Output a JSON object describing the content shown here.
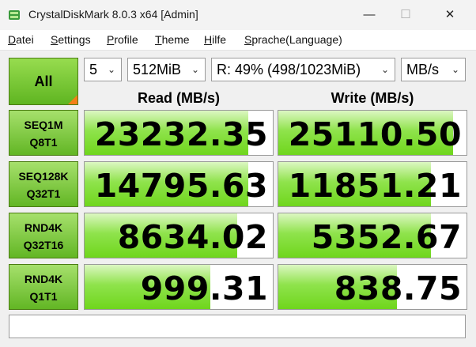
{
  "window": {
    "title": "CrystalDiskMark 8.0.3 x64 [Admin]",
    "minimize": "—",
    "maximize": "☐",
    "close": "✕"
  },
  "menu": [
    {
      "u": "D",
      "rest": "atei"
    },
    {
      "u": "S",
      "rest": "ettings"
    },
    {
      "u": "P",
      "rest": "rofile"
    },
    {
      "u": "T",
      "rest": "heme"
    },
    {
      "u": "H",
      "rest": "ilfe"
    },
    {
      "u": "S",
      "rest": "prache(Language)"
    }
  ],
  "controls": {
    "all_label": "All",
    "count": "5",
    "size": "512MiB",
    "drive": "R: 49% (498/1023MiB)",
    "unit": "MB/s"
  },
  "headers": {
    "read": "Read (MB/s)",
    "write": "Write (MB/s)"
  },
  "tests": [
    {
      "l1": "SEQ1M",
      "l2": "Q8T1",
      "read": "23232.35",
      "write": "25110.50",
      "read_fill": 0.87,
      "write_fill": 0.93
    },
    {
      "l1": "SEQ128K",
      "l2": "Q32T1",
      "read": "14795.63",
      "write": "11851.21",
      "read_fill": 0.87,
      "write_fill": 0.81
    },
    {
      "l1": "RND4K",
      "l2": "Q32T16",
      "read": "8634.02",
      "write": "5352.67",
      "read_fill": 0.81,
      "write_fill": 0.81
    },
    {
      "l1": "RND4K",
      "l2": "Q1T1",
      "read": "999.31",
      "write": "838.75",
      "read_fill": 0.67,
      "write_fill": 0.63
    }
  ],
  "comment": "",
  "colors": {
    "accent_green": "#6fd61c",
    "corner_orange": "#f47f17"
  }
}
